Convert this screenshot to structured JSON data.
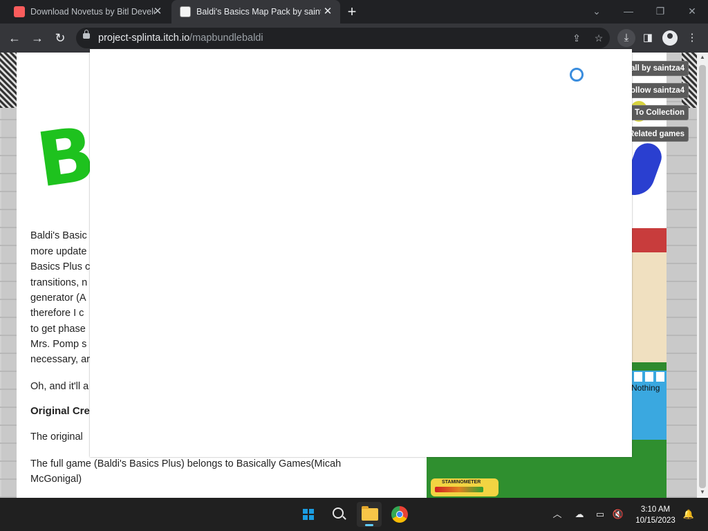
{
  "tabs": [
    {
      "title": "Download Novetus by Bitl Develo",
      "favicon": "itch-icon"
    },
    {
      "title": "Baldi's Basics Map Pack by saintz",
      "favicon": "baldi-flag-icon"
    }
  ],
  "address": {
    "host": "project-splinta.itch.io",
    "path": "/mapbundlebaldi"
  },
  "page": {
    "lines": [
      "Baldi's Basic",
      "more update",
      "Basics Plus c",
      "transitions, n",
      "generator (A",
      "therefore I c",
      "to get phase",
      "Mrs. Pomp s",
      "necessary, ar"
    ],
    "oh_line": "Oh, and it'll a",
    "credits_heading": "Original Cre",
    "original_line": "The original",
    "full_game_line1": "The full game (Baldi's Basics Plus) belongs to Basically Games(Micah",
    "full_game_line2": "McGonigal)"
  },
  "art": {
    "nothing_label": "Nothing",
    "stamina_label": "STAMINOMETER"
  },
  "itch_actions": [
    {
      "label": "all by saintza4"
    },
    {
      "label": "ollow saintza4"
    },
    {
      "label": "d To Collection"
    },
    {
      "label": "Related games"
    }
  ],
  "taskbar": {
    "time": "3:10 AM",
    "date": "10/15/2023"
  },
  "colors": {
    "logo_green": "#1ec21e",
    "spinner_blue": "#3a8dde",
    "tab_bg": "#202124",
    "toolbar_bg": "#35363a"
  }
}
